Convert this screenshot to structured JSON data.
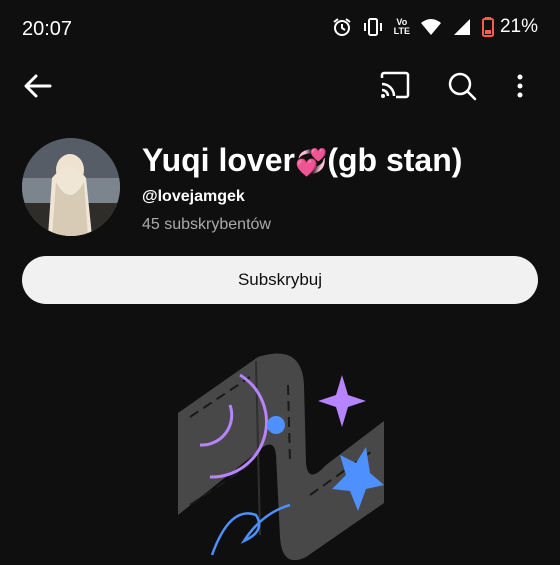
{
  "status_bar": {
    "time": "20:07",
    "volte_line1": "Vo",
    "volte_line2": "LTE",
    "battery": "21%"
  },
  "app_bar": {
    "back_icon": "arrow-left-icon",
    "cast_icon": "cast-icon",
    "search_icon": "search-icon",
    "more_icon": "more-vertical-icon"
  },
  "channel": {
    "name": "Yuqi lover",
    "name_emoji": "💞",
    "name_suffix": "(gb stan)",
    "handle": "@lovejamgek",
    "subscribers": "45 subskrybentów",
    "subscribe_label": "Subskrybuj"
  },
  "colors": {
    "background": "#0f0f0f",
    "button_bg": "#f1f1f1",
    "accent_purple": "#b784ff",
    "accent_blue": "#4d90fe",
    "battery_red": "#ff5c4d"
  }
}
